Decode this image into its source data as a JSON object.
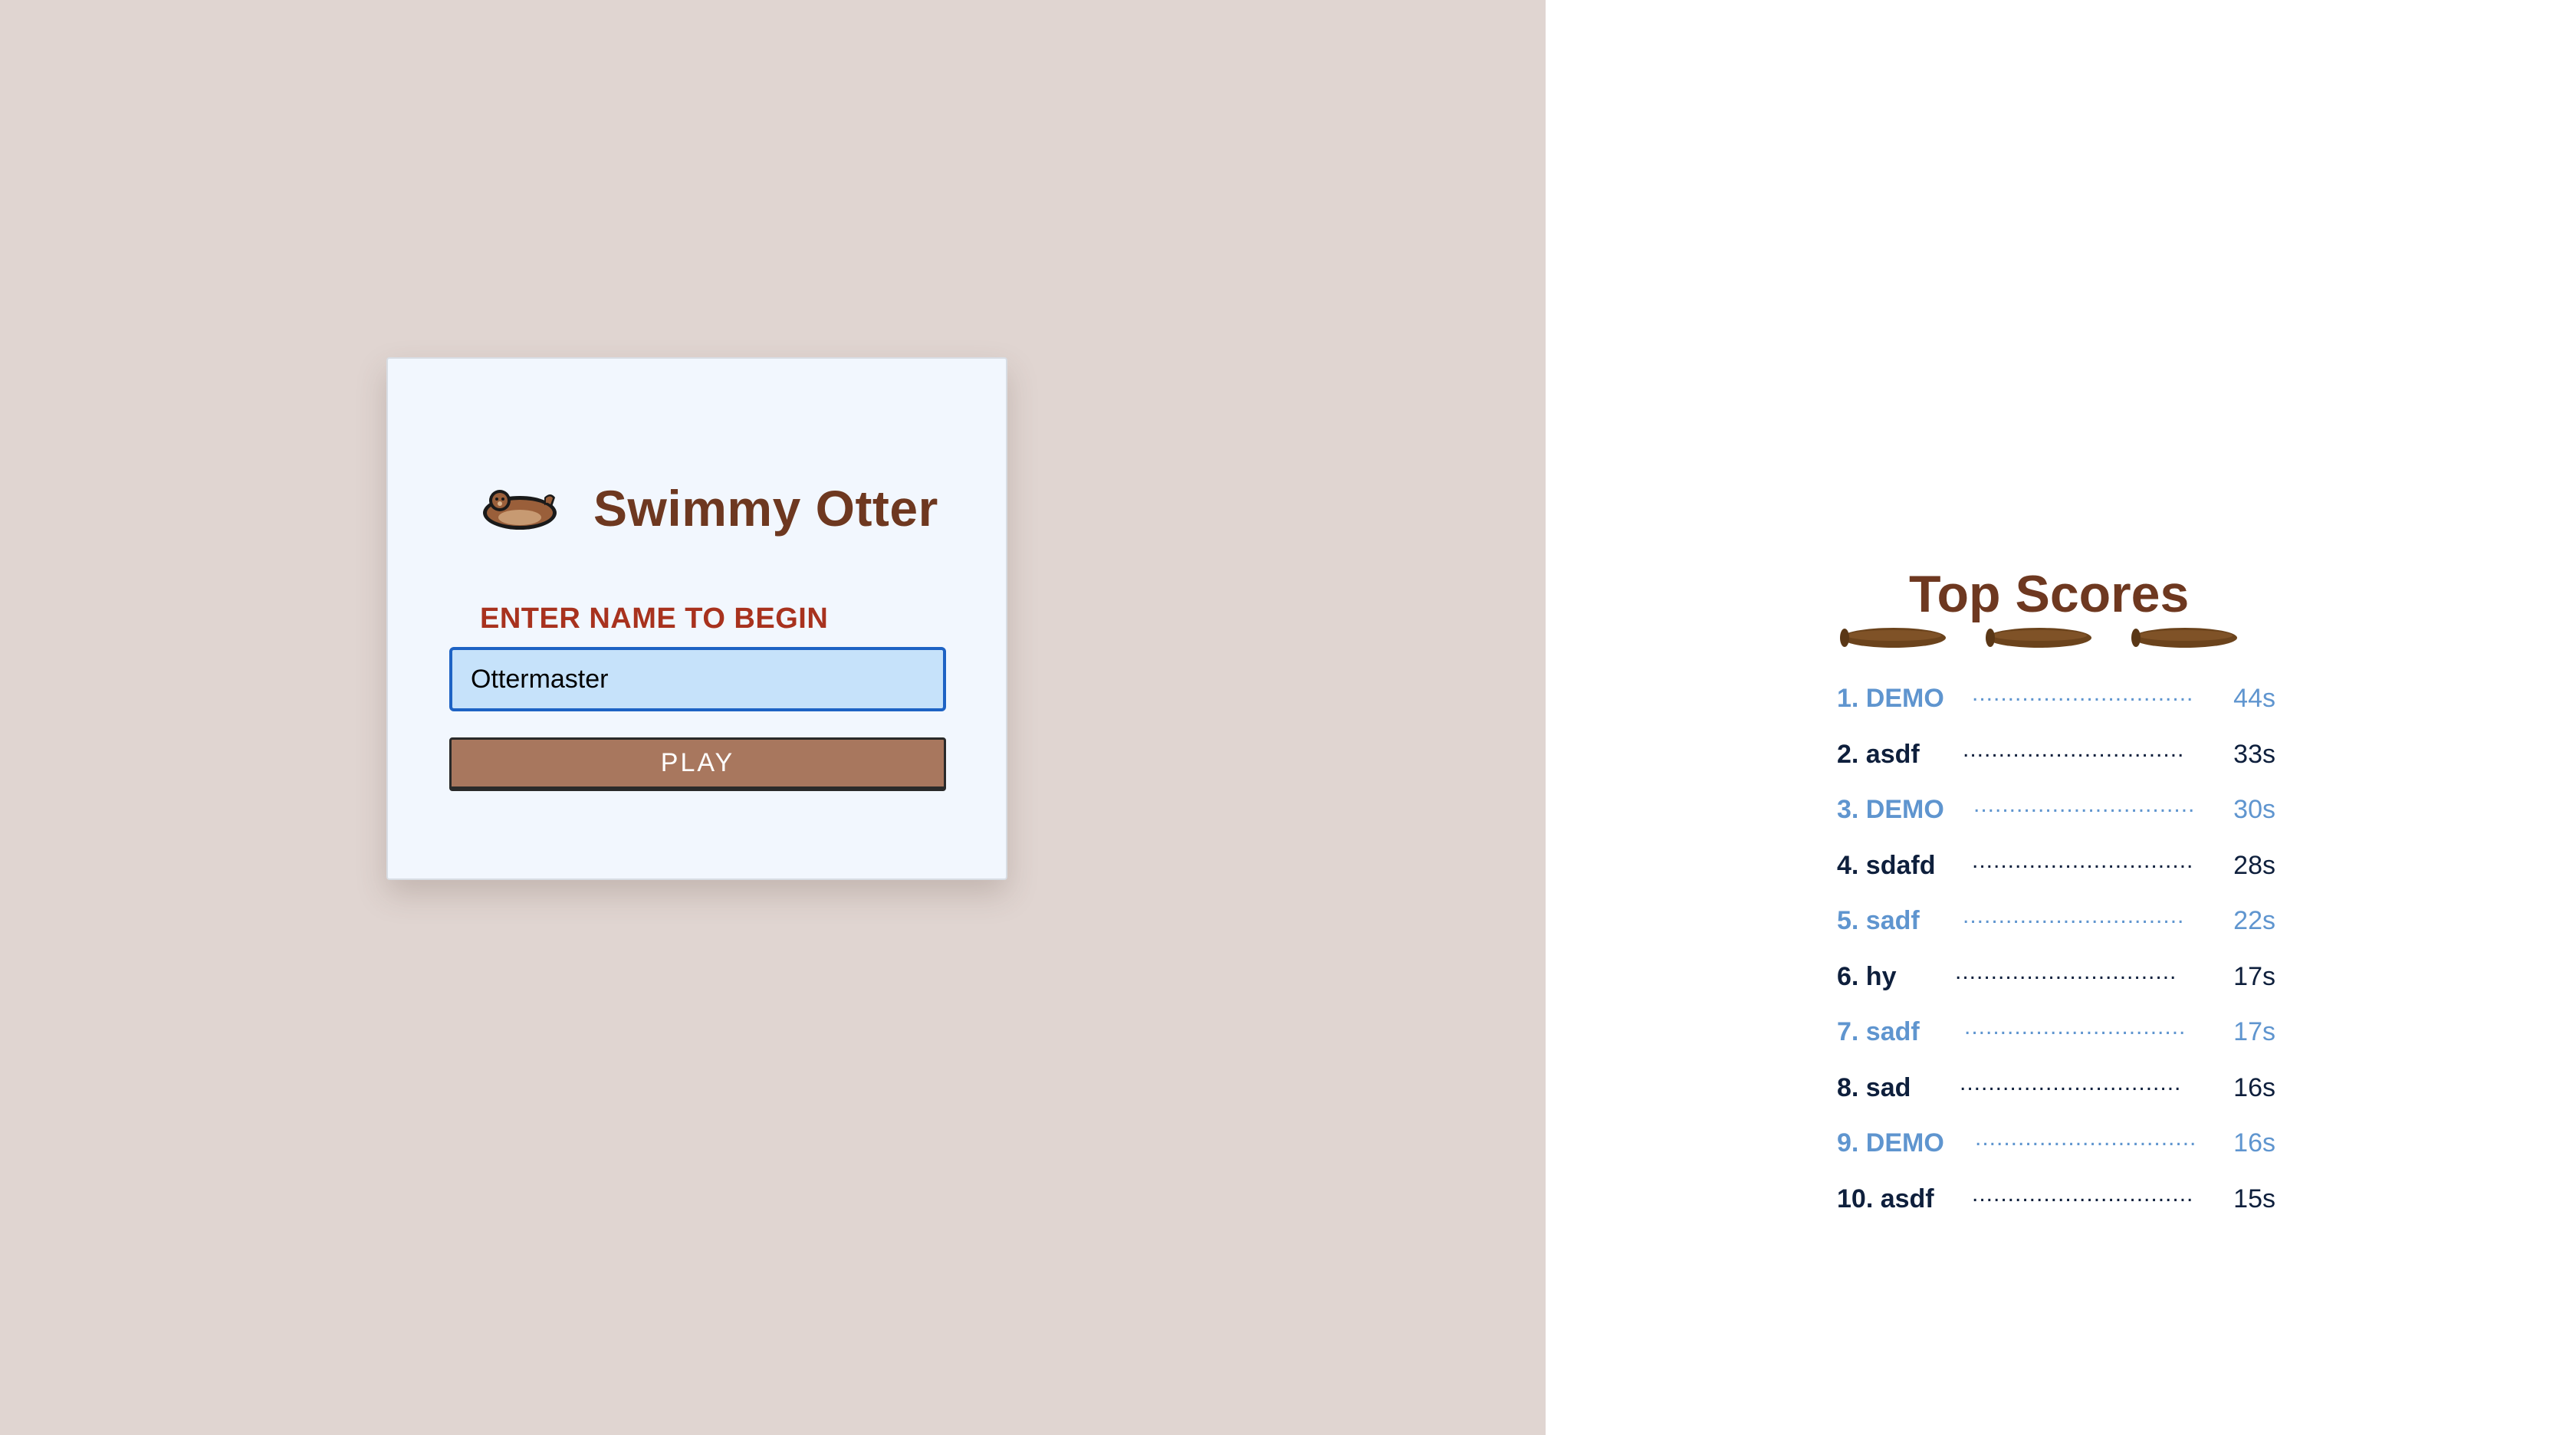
{
  "game": {
    "title": "Swimmy Otter",
    "otter_icon": "otter-icon",
    "name_label": "ENTER NAME TO BEGIN",
    "name_value": "Ottermaster",
    "play_label": "PLAY"
  },
  "scoreboard": {
    "title": "Top Scores",
    "decoration_icon": "log-icon",
    "dots": "................................",
    "entries": [
      {
        "rank_name": "1. DEMO",
        "time": "44s"
      },
      {
        "rank_name": "2. asdf",
        "time": "33s"
      },
      {
        "rank_name": "3. DEMO",
        "time": "30s"
      },
      {
        "rank_name": "4. sdafd",
        "time": "28s"
      },
      {
        "rank_name": "5. sadf",
        "time": "22s"
      },
      {
        "rank_name": "6. hy",
        "time": "17s"
      },
      {
        "rank_name": "7. sadf",
        "time": "17s"
      },
      {
        "rank_name": "8. sad",
        "time": "16s"
      },
      {
        "rank_name": "9. DEMO",
        "time": "16s"
      },
      {
        "rank_name": "10. asdf",
        "time": "15s"
      }
    ]
  },
  "colors": {
    "left_background": "#e0d5d1",
    "card_background": "#f2f7fe",
    "title_brown": "#6e3820",
    "label_red": "#a8321e",
    "input_background": "#c6e2fa",
    "input_border": "#1e63c4",
    "button_background": "#a8775e",
    "score_light": "#5f95cf",
    "score_dark": "#0e1f3c"
  }
}
